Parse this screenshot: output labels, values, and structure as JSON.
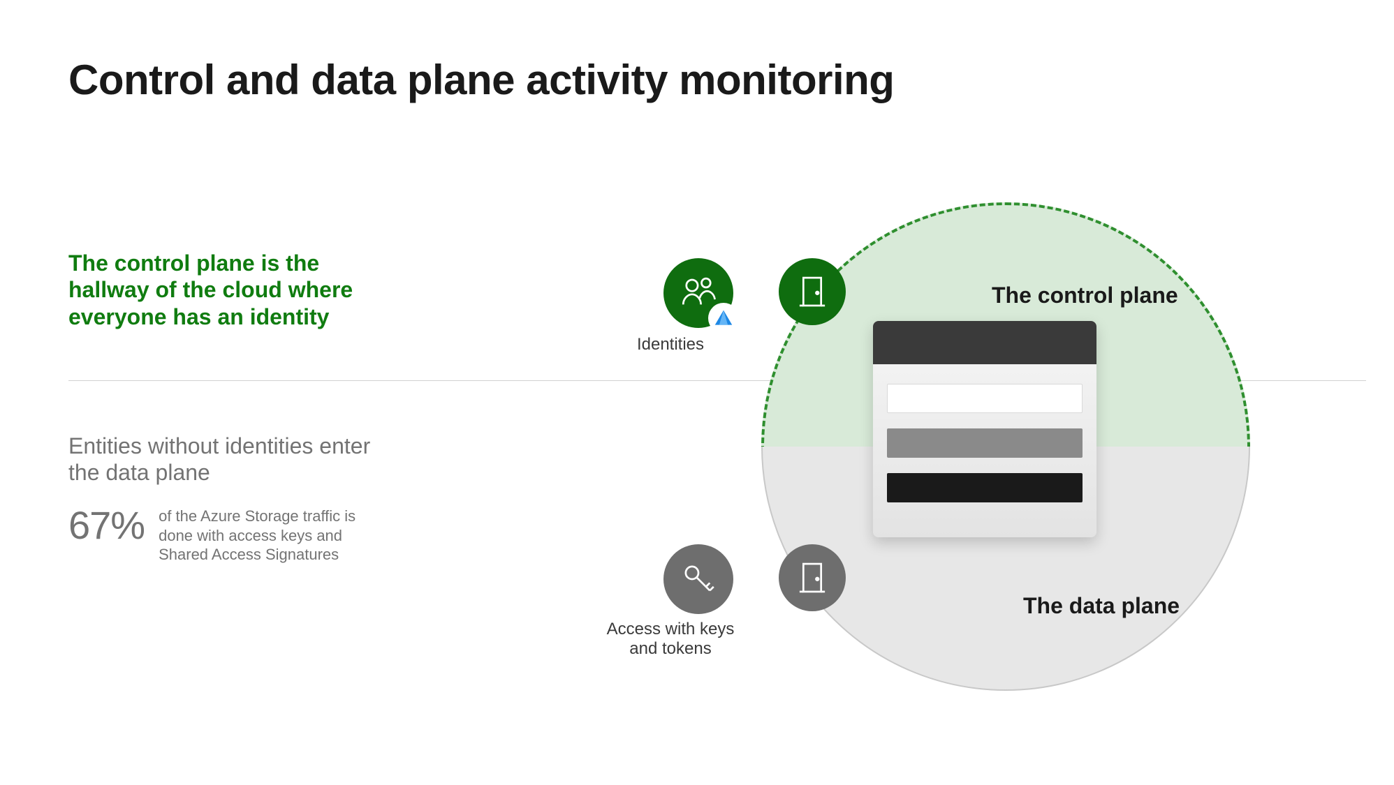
{
  "title": "Control and data plane activity monitoring",
  "control_plane": {
    "description": "The control plane is the hallway of the cloud where everyone has an identity",
    "label": "The control plane",
    "identities_label": "Identities"
  },
  "data_plane": {
    "description": "Entities without identities enter the data plane",
    "label": "The data plane",
    "access_label": "Access with keys and tokens",
    "stat": {
      "value": "67%",
      "caption": "of the Azure Storage traffic is done with access keys and Shared Access Signatures"
    }
  },
  "colors": {
    "green": "#107c10",
    "grey_text": "#737373"
  }
}
